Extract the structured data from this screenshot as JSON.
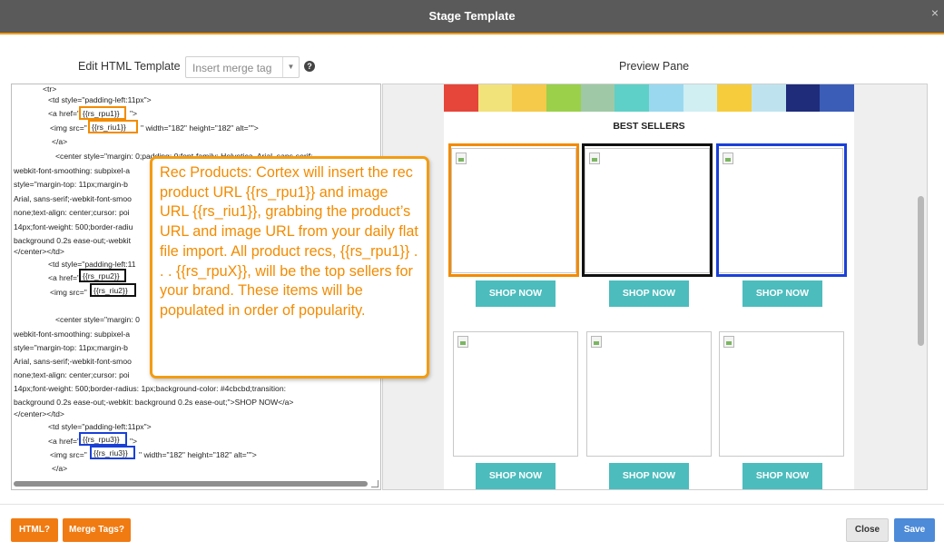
{
  "dialog": {
    "title": "Stage Template",
    "close_glyph": "×"
  },
  "editor": {
    "label": "Edit HTML Template",
    "merge_placeholder": "Insert merge tag",
    "help_glyph": "?",
    "code_lines": [
      "<tr>",
      "<td style=\"padding-left:11px\">",
      "<a href=\"",
      "\">",
      "<img  src=\"",
      "\" width=\"182\" height=\"182\" alt=\"\">",
      "</a>",
      "<center style=\"margin: 0;padding: 0;font-family: Helvetica, Arial, sans-serif;-",
      "webkit-font-smoothing: subpixel-a",
      "style=\"margin-top: 11px;margin-b",
      "Arial, sans-serif;-webkit-font-smoo",
      "none;text-align: center;cursor: poi",
      "14px;font-weight: 500;border-radiu",
      "background 0.2s ease-out;-webkit",
      "</center></td>",
      "<td style=\"padding-left:11",
      "<a href=\"",
      "<img  src=\"",
      "<center style=\"margin: 0",
      "webkit-font-smoothing: subpixel-a",
      "style=\"margin-top: 11px;margin-b",
      "Arial, sans-serif;-webkit-font-smoo",
      "none;text-align: center;cursor: poi",
      "14px;font-weight: 500;border-radius: 1px;background-color: #4cbcbd;transition:",
      "background 0.2s ease-out;-webkit: background 0.2s ease-out;\">SHOP NOW</a>",
      "</center></td>",
      "<td style=\"padding-left:11px\">",
      "<a href=\"",
      "\">",
      "<img  src=\"",
      "\" width=\"182\" height=\"182\" alt=\"\">",
      "</a>"
    ],
    "merge_tags": {
      "rpu1": "{{rs_rpu1}}",
      "riu1": "{{rs_riu1}}",
      "rpu2": "{{rs_rpu2}}",
      "riu2": "{{rs_riu2}}",
      "rpu3": "{{rs_rpu3}}",
      "riu3": "{{rs_riu3}}"
    }
  },
  "preview": {
    "label": "Preview Pane",
    "section_title": "BEST SELLERS",
    "buttons": [
      "SHOP NOW",
      "SHOP NOW",
      "SHOP NOW",
      "SHOP NOW",
      "SHOP NOW",
      "SHOP NOW"
    ],
    "banner_colors": [
      "#e6453a",
      "#f2e27a",
      "#f5c94a",
      "#9bd04a",
      "#9fc8a6",
      "#5fd0c7",
      "#9ad8f0",
      "#cfeff3",
      "#f6cc3c",
      "#bfe3ee",
      "#1e2c7a",
      "#3b5db8"
    ]
  },
  "callout": {
    "text": "Rec Products: Cortex will insert the rec product URL {{rs_rpu1}} and image URL {{rs_riu1}}, grabbing the product’s URL and image URL from your daily flat file import. All product recs, {{rs_rpu1}} . . . {{rs_rpuX}}, will be the top sellers for your brand. These items will be populated in order of popularity."
  },
  "footer": {
    "html_button": "HTML?",
    "merge_tags_button": "Merge Tags?",
    "close_button": "Close",
    "save_button": "Save"
  },
  "colors": {
    "accent_orange": "#f39c12",
    "highlight_blue": "#1a40d8",
    "shop_button": "#4cbcbd",
    "save_button": "#4d8ad8"
  }
}
